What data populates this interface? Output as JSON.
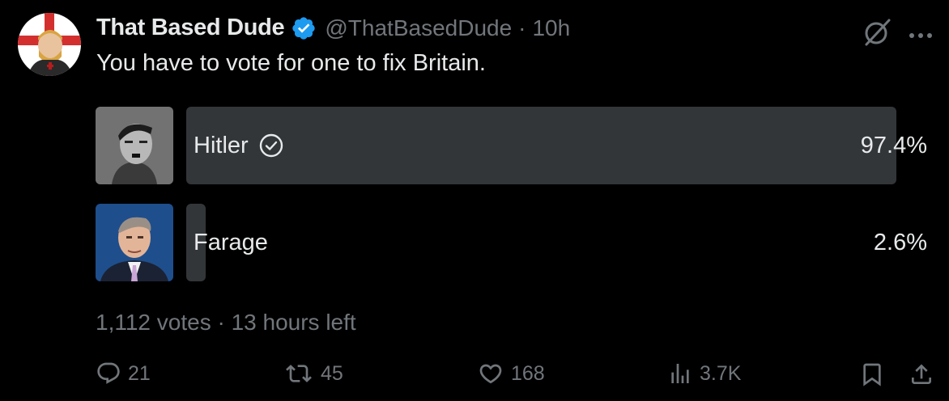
{
  "post": {
    "author_name": "That Based Dude",
    "handle": "@ThatBasedDude",
    "separator": "·",
    "time": "10h",
    "text": "You have to vote for one to fix Britain."
  },
  "poll": {
    "options": [
      {
        "label": "Hitler",
        "percent": "97.4%",
        "share": 0.974,
        "winner": true
      },
      {
        "label": "Farage",
        "percent": "2.6%",
        "share": 0.026,
        "winner": false
      }
    ],
    "votes": "1,112 votes",
    "separator": "·",
    "time_left": "13 hours left"
  },
  "actions": {
    "replies": "21",
    "reposts": "45",
    "likes": "168",
    "views": "3.7K"
  },
  "icons": {
    "verified": "verified-badge-icon",
    "grok": "grok-icon",
    "more": "more-options-icon",
    "check": "checkmark-circle-icon",
    "reply": "reply-icon",
    "repost": "repost-icon",
    "like": "heart-icon",
    "views": "analytics-icon",
    "bookmark": "bookmark-icon",
    "share": "share-icon"
  },
  "colors": {
    "background": "#000000",
    "text": "#e7e9ea",
    "muted": "#71767b",
    "bar": "#333639",
    "verified_blue": "#1d9bf0"
  }
}
